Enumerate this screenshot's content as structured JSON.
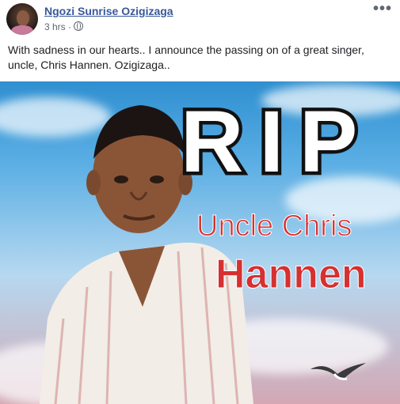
{
  "post": {
    "author": "Ngozi Sunrise Ozigizaga",
    "time": "3 hrs",
    "separator": "·",
    "more_icon": "more-horizontal-icon",
    "privacy_icon": "globe-icon",
    "text": "With sadness in our hearts.. I announce the passing on of a great singer, uncle, Chris Hannen. Ozigizaga.."
  },
  "image": {
    "title": "RIP",
    "line1": "Uncle Chris",
    "line2": "Hannen"
  }
}
